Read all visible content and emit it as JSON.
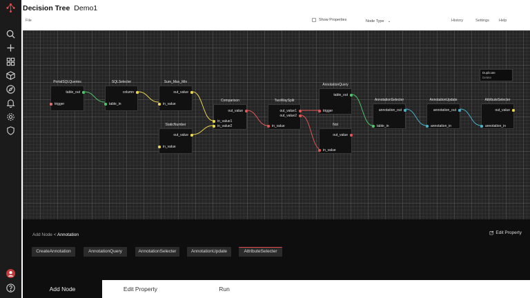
{
  "header": {
    "title": "Decision Tree",
    "subtitle": "Demo1",
    "file_menu": "File",
    "show_properties": "Show Properties",
    "node_type": "Node Type",
    "links": [
      "History",
      "Settings",
      "Help"
    ]
  },
  "rail": {
    "icons": [
      "logo-icon",
      "search-icon",
      "add-icon",
      "grid-icon",
      "cube-icon",
      "compass-icon",
      "bell-icon",
      "gear-icon",
      "shield-icon",
      "avatar-icon",
      "help-icon"
    ]
  },
  "canvas": {
    "context_menu": [
      "Duplicate",
      "Delete"
    ],
    "nodes": [
      {
        "title": "PortalSQLQueries",
        "outputs": [
          "table_out"
        ],
        "inputs": [
          "trigger"
        ]
      },
      {
        "title": "SQLSelecter",
        "outputs": [
          "column"
        ],
        "inputs": [
          "table_in"
        ]
      },
      {
        "title": "Sum_Max_Min",
        "outputs": [
          "out_value"
        ],
        "inputs": [
          "in_value"
        ]
      },
      {
        "title": "StaticNumber",
        "outputs": [
          "out_value"
        ],
        "inputs": [
          "in_value"
        ]
      },
      {
        "title": "Comparison",
        "outputs": [
          "out_value"
        ],
        "inputs": [
          "in_value1",
          "in_value2"
        ]
      },
      {
        "title": "TwoWaySplit",
        "outputs": [
          "out_value1",
          "out_value2"
        ],
        "inputs": [
          "in_value"
        ]
      },
      {
        "title": "AnnotationQuery",
        "outputs": [
          "table_out"
        ],
        "inputs": [
          "trigger"
        ]
      },
      {
        "title": "Not",
        "outputs": [
          "out_value"
        ],
        "inputs": [
          "in_value"
        ]
      },
      {
        "title": "AnnotationSelecter",
        "outputs": [
          "annotation_out"
        ],
        "inputs": [
          "table_in"
        ]
      },
      {
        "title": "AnnotationUpdate",
        "outputs": [
          "annotation_out"
        ],
        "inputs": [
          "annotation_in"
        ]
      },
      {
        "title": "AttributeSelecter",
        "outputs": [
          "out_value"
        ],
        "inputs": [
          "annotation_in"
        ]
      }
    ]
  },
  "panel": {
    "breadcrumb_root": "Add Node <",
    "breadcrumb_current": "Annotation",
    "edit_property_link": "Edit Property",
    "chips": [
      "CreateAnnotation",
      "AnnotationQuery",
      "AnnotationSelecter",
      "AnnotationUpdate",
      "AttributeSelecter"
    ],
    "active_chip": "AttributeSelecter"
  },
  "tabs": [
    "Add Node",
    "Edit Property",
    "Run"
  ],
  "active_tab": "Add Node",
  "colors": {
    "table": "#4cc46a",
    "number": "#e8d44d",
    "boolean": "#e05555",
    "annotation": "#49b0c8",
    "trigger": "#e07070",
    "accent": "#e04b4b"
  }
}
